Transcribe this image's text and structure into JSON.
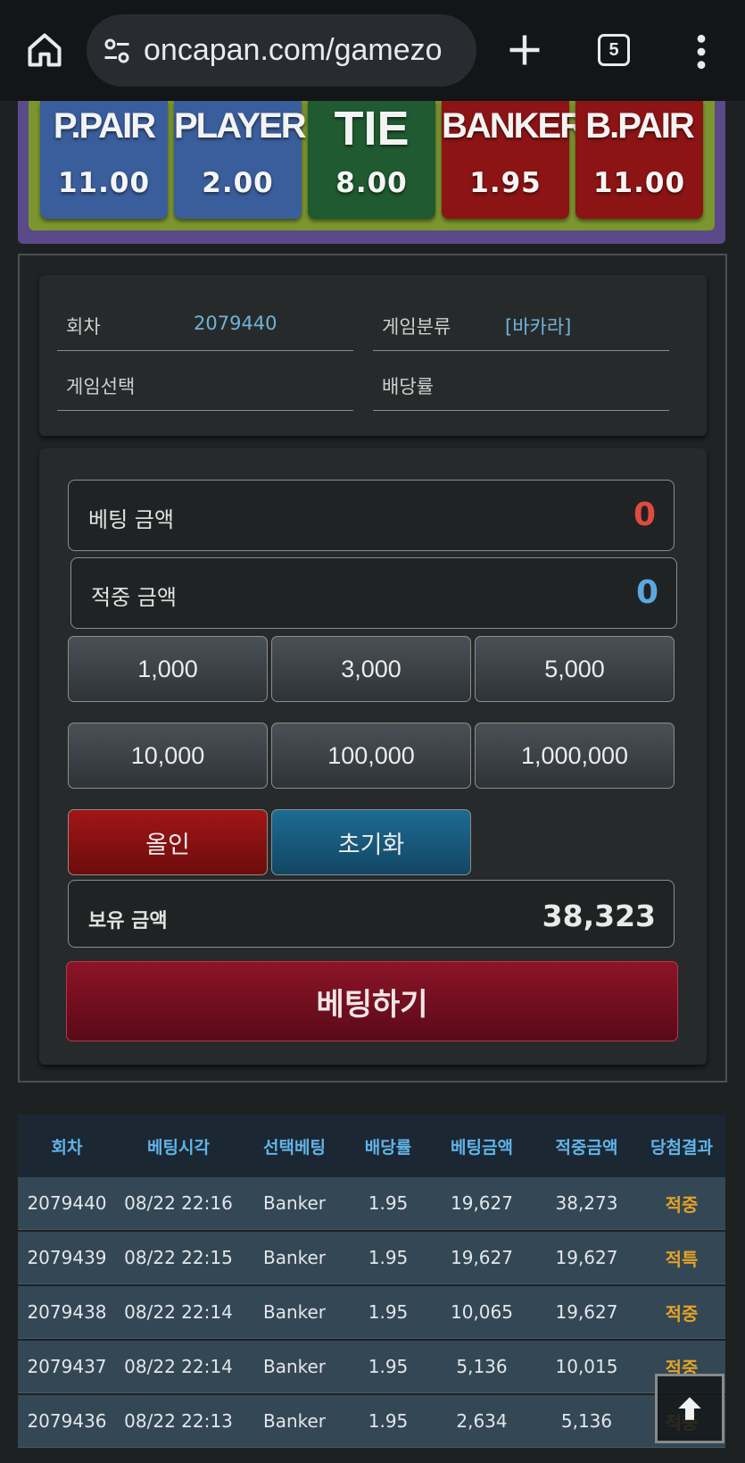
{
  "browser": {
    "url": "oncapan.com/gamezo",
    "tab_count": "5"
  },
  "odds": [
    {
      "name": "P.PAIR",
      "odd": "11.00",
      "color": "#3a5e9c"
    },
    {
      "name": "PLAYER",
      "odd": "2.00",
      "color": "#3a5e9c"
    },
    {
      "name": "TIE",
      "odd": "8.00",
      "color": "#1f5a30"
    },
    {
      "name": "BANKER",
      "odd": "1.95",
      "color": "#8c1414"
    },
    {
      "name": "B.PAIR",
      "odd": "11.00",
      "color": "#8c1414"
    }
  ],
  "info": {
    "round_label": "회차",
    "round_value": "2079440",
    "category_label": "게임분류",
    "category_value": "[바카라]",
    "selection_label": "게임선택",
    "odds_label": "배당률"
  },
  "bet": {
    "bet_amount_label": "베팅 금액",
    "bet_amount_value": "0",
    "win_amount_label": "적중 금액",
    "win_amount_value": "0",
    "chips": [
      "1,000",
      "3,000",
      "5,000",
      "10,000",
      "100,000",
      "1,000,000"
    ],
    "allin_label": "올인",
    "reset_label": "초기화",
    "balance_label": "보유 금액",
    "balance_value": "38,323",
    "submit_label": "베팅하기"
  },
  "history": {
    "headers": [
      "회차",
      "베팅시각",
      "선택베팅",
      "배당률",
      "베팅금액",
      "적중금액",
      "당첨결과"
    ],
    "rows": [
      [
        "2079440",
        "08/22 22:16",
        "Banker",
        "1.95",
        "19,627",
        "38,273",
        "적중"
      ],
      [
        "2079439",
        "08/22 22:15",
        "Banker",
        "1.95",
        "19,627",
        "19,627",
        "적특"
      ],
      [
        "2079438",
        "08/22 22:14",
        "Banker",
        "1.95",
        "10,065",
        "19,627",
        "적중"
      ],
      [
        "2079437",
        "08/22 22:14",
        "Banker",
        "1.95",
        "5,136",
        "10,015",
        "적중"
      ],
      [
        "2079436",
        "08/22 22:13",
        "Banker",
        "1.95",
        "2,634",
        "5,136",
        "적중"
      ]
    ]
  }
}
